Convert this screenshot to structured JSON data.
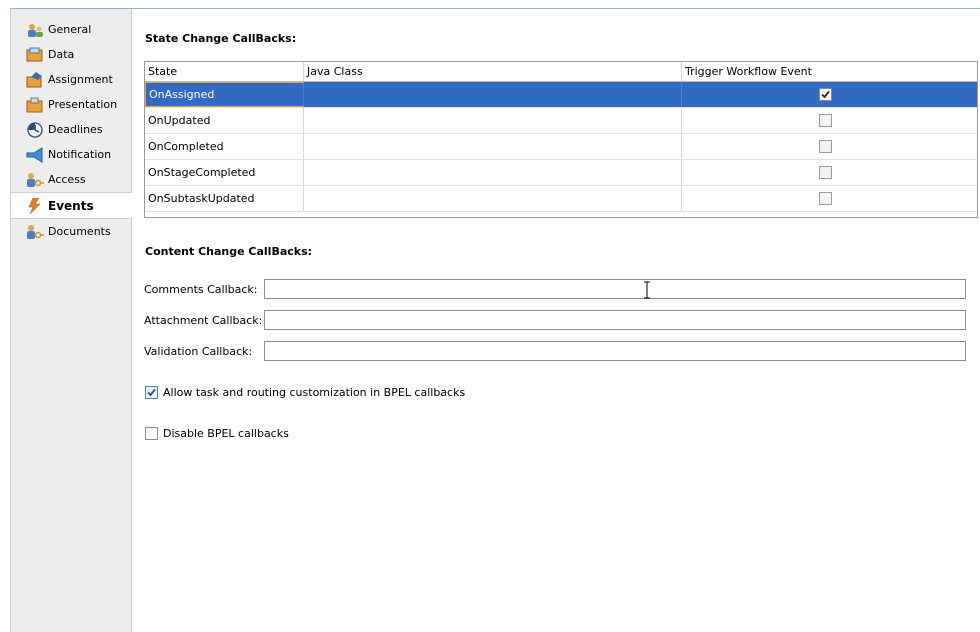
{
  "nav": {
    "items": [
      {
        "label": "General",
        "icon": "general-icon"
      },
      {
        "label": "Data",
        "icon": "data-icon"
      },
      {
        "label": "Assignment",
        "icon": "assignment-icon"
      },
      {
        "label": "Presentation",
        "icon": "presentation-icon"
      },
      {
        "label": "Deadlines",
        "icon": "deadlines-icon"
      },
      {
        "label": "Notification",
        "icon": "notification-icon"
      },
      {
        "label": "Access",
        "icon": "access-icon"
      },
      {
        "label": "Events",
        "icon": "events-icon",
        "active": true
      },
      {
        "label": "Documents",
        "icon": "documents-icon"
      }
    ]
  },
  "state_callbacks": {
    "title": "State Change CallBacks:",
    "columns": [
      "State",
      "Java Class",
      "Trigger Workflow Event"
    ],
    "rows": [
      {
        "state": "OnAssigned",
        "java_class": "",
        "trigger": true,
        "selected": true
      },
      {
        "state": "OnUpdated",
        "java_class": "",
        "trigger": false
      },
      {
        "state": "OnCompleted",
        "java_class": "",
        "trigger": false
      },
      {
        "state": "OnStageCompleted",
        "java_class": "",
        "trigger": false
      },
      {
        "state": "OnSubtaskUpdated",
        "java_class": "",
        "trigger": false
      }
    ]
  },
  "content_callbacks": {
    "title": "Content Change CallBacks:",
    "comments_label": "Comments Callback:",
    "comments_value": "",
    "attachment_label": "Attachment Callback:",
    "attachment_value": "",
    "validation_label": "Validation Callback:",
    "validation_value": ""
  },
  "options": {
    "allow_customization_label": "Allow task and routing customization in BPEL callbacks",
    "allow_customization_checked": true,
    "disable_bpel_label": "Disable BPEL callbacks",
    "disable_bpel_checked": false
  },
  "colors": {
    "selection": "#316ac5",
    "nav_bg": "#ededed",
    "focus_border": "#e4a93a"
  }
}
